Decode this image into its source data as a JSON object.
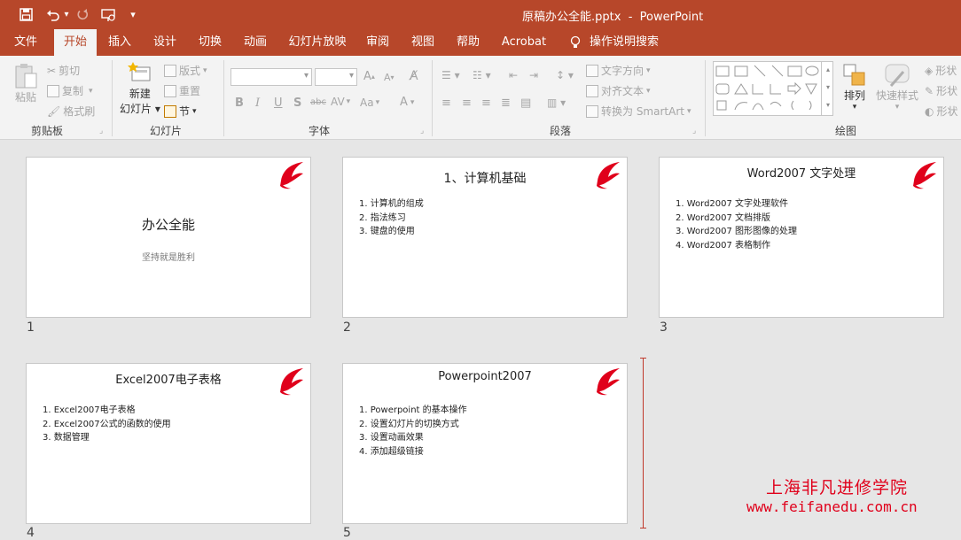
{
  "window": {
    "title": "原稿办公全能.pptx  -  PowerPoint"
  },
  "qat": {
    "save_icon": "save-icon",
    "undo_icon": "undo-icon",
    "redo_icon": "redo-icon",
    "present_icon": "present-from-start-icon",
    "customize_icon": "customize-qat-icon"
  },
  "tabs": [
    {
      "label": "文件"
    },
    {
      "label": "开始"
    },
    {
      "label": "插入"
    },
    {
      "label": "设计"
    },
    {
      "label": "切换"
    },
    {
      "label": "动画"
    },
    {
      "label": "幻灯片放映"
    },
    {
      "label": "审阅"
    },
    {
      "label": "视图"
    },
    {
      "label": "帮助"
    },
    {
      "label": "Acrobat"
    },
    {
      "label": "操作说明搜索"
    }
  ],
  "ribbon": {
    "clipboard": {
      "paste": "粘贴",
      "cut": "剪切",
      "copy": "复制",
      "format_painter": "格式刷",
      "group": "剪贴板"
    },
    "slides": {
      "new_slide_line1": "新建",
      "new_slide_line2": "幻灯片",
      "layout": "版式",
      "reset": "重置",
      "section": "节",
      "group": "幻灯片"
    },
    "font": {
      "bold": "B",
      "italic": "I",
      "underline": "U",
      "shadow": "S",
      "strike": "abc",
      "spacing": "AV",
      "case": "Aa",
      "color": "A",
      "grow": "A",
      "shrink": "A",
      "group": "字体"
    },
    "paragraph": {
      "text_direction": "文字方向",
      "align_text": "对齐文本",
      "smartart": "转换为 SmartArt",
      "group": "段落"
    },
    "drawing": {
      "arrange": "排列",
      "quick_styles": "快速样式",
      "shape_fill": "形状",
      "shape_outline": "形状",
      "shape_effects": "形状",
      "group": "绘图"
    }
  },
  "slides": [
    {
      "number": "1",
      "title": "办公全能",
      "subtitle": "坚持就是胜利",
      "bullets": []
    },
    {
      "number": "2",
      "title": "1、计算机基础",
      "bullets": [
        "1. 计算机的组成",
        "2. 指法练习",
        "3. 键盘的使用"
      ]
    },
    {
      "number": "3",
      "title": "Word2007 文字处理",
      "bullets": [
        "1. Word2007 文字处理软件",
        "2. Word2007 文档排版",
        "3. Word2007 图形图像的处理",
        "4. Word2007 表格制作"
      ]
    },
    {
      "number": "4",
      "title": "Excel2007电子表格",
      "bullets": [
        "1. Excel2007电子表格",
        "2. Excel2007公式的函数的使用",
        "3. 数据管理"
      ]
    },
    {
      "number": "5",
      "title": "Powerpoint2007",
      "bullets": [
        "1. Powerpoint 的基本操作",
        "2. 设置幻灯片的切换方式",
        "3. 设置动画效果",
        "4. 添加超级链接"
      ]
    }
  ],
  "watermark": {
    "line1": "上海非凡进修学院",
    "line2": "www.feifanedu.com.cn"
  },
  "colors": {
    "accent": "#b7472a",
    "logo_red": "#e0001b"
  }
}
